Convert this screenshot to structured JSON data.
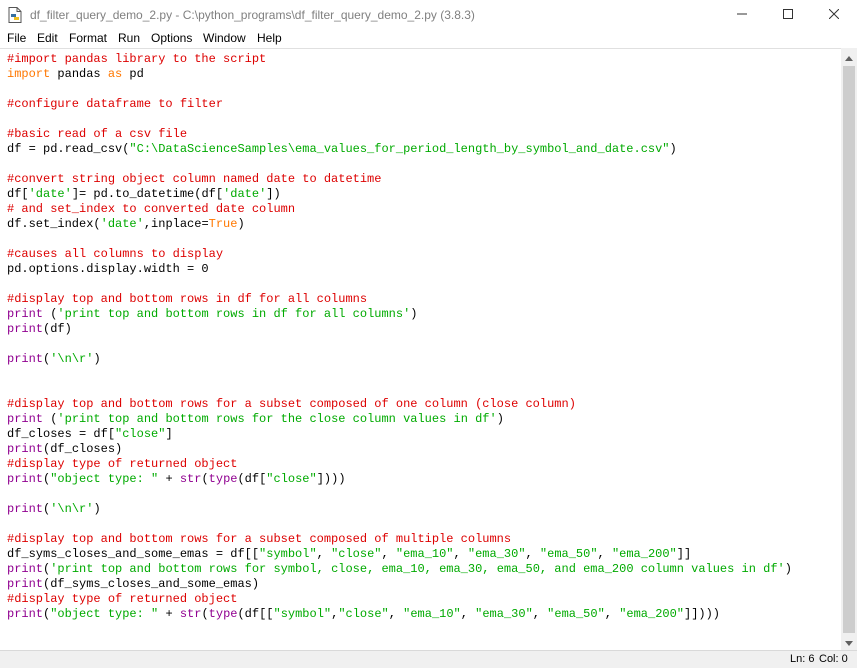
{
  "window": {
    "title": "df_filter_query_demo_2.py - C:\\python_programs\\df_filter_query_demo_2.py (3.8.3)",
    "controls": {
      "minimize": "minimize",
      "maximize": "maximize",
      "close": "close"
    }
  },
  "menu": {
    "items": [
      "File",
      "Edit",
      "Format",
      "Run",
      "Options",
      "Window",
      "Help"
    ]
  },
  "editor": {
    "colors": {
      "comment": "#dd0000",
      "keyword": "#ff7700",
      "builtin": "#900090",
      "string": "#00aa00",
      "default": "#000000"
    },
    "lines": [
      [
        [
          "comment",
          "#import pandas library to the script"
        ]
      ],
      [
        [
          "kw",
          "import"
        ],
        [
          "t",
          " pandas "
        ],
        [
          "kw",
          "as"
        ],
        [
          "t",
          " pd"
        ]
      ],
      [],
      [
        [
          "comment",
          "#configure dataframe to filter"
        ]
      ],
      [],
      [
        [
          "comment",
          "#basic read of a csv file"
        ]
      ],
      [
        [
          "t",
          "df = pd.read_csv("
        ],
        [
          "str",
          "\"C:\\DataScienceSamples\\ema_values_for_period_length_by_symbol_and_date.csv\""
        ],
        [
          "t",
          ")"
        ]
      ],
      [],
      [
        [
          "comment",
          "#convert string object column named date to datetime"
        ]
      ],
      [
        [
          "t",
          "df["
        ],
        [
          "str",
          "'date'"
        ],
        [
          "t",
          "]= pd.to_datetime(df["
        ],
        [
          "str",
          "'date'"
        ],
        [
          "t",
          "])"
        ]
      ],
      [
        [
          "comment",
          "# and set_index to converted date column"
        ]
      ],
      [
        [
          "t",
          "df.set_index("
        ],
        [
          "str",
          "'date'"
        ],
        [
          "t",
          ",inplace="
        ],
        [
          "kw",
          "True"
        ],
        [
          "t",
          ")"
        ]
      ],
      [],
      [
        [
          "comment",
          "#causes all columns to display"
        ]
      ],
      [
        [
          "t",
          "pd.options.display.width = 0"
        ]
      ],
      [],
      [
        [
          "comment",
          "#display top and bottom rows in df for all columns"
        ]
      ],
      [
        [
          "bi",
          "print"
        ],
        [
          "t",
          " ("
        ],
        [
          "str",
          "'print top and bottom rows in df for all columns'"
        ],
        [
          "t",
          ")"
        ]
      ],
      [
        [
          "bi",
          "print"
        ],
        [
          "t",
          "(df)"
        ]
      ],
      [],
      [
        [
          "bi",
          "print"
        ],
        [
          "t",
          "("
        ],
        [
          "str",
          "'\\n\\r'"
        ],
        [
          "t",
          ")"
        ]
      ],
      [],
      [],
      [
        [
          "comment",
          "#display top and bottom rows for a subset composed of one column (close column)"
        ]
      ],
      [
        [
          "bi",
          "print"
        ],
        [
          "t",
          " ("
        ],
        [
          "str",
          "'print top and bottom rows for the close column values in df'"
        ],
        [
          "t",
          ")"
        ]
      ],
      [
        [
          "t",
          "df_closes = df["
        ],
        [
          "str",
          "\"close\""
        ],
        [
          "t",
          "]"
        ]
      ],
      [
        [
          "bi",
          "print"
        ],
        [
          "t",
          "(df_closes)"
        ]
      ],
      [
        [
          "comment",
          "#display type of returned object"
        ]
      ],
      [
        [
          "bi",
          "print"
        ],
        [
          "t",
          "("
        ],
        [
          "str",
          "\"object type: \""
        ],
        [
          "t",
          " + "
        ],
        [
          "bi",
          "str"
        ],
        [
          "t",
          "("
        ],
        [
          "bi",
          "type"
        ],
        [
          "t",
          "(df["
        ],
        [
          "str",
          "\"close\""
        ],
        [
          "t",
          "])))"
        ]
      ],
      [],
      [
        [
          "bi",
          "print"
        ],
        [
          "t",
          "("
        ],
        [
          "str",
          "'\\n\\r'"
        ],
        [
          "t",
          ")"
        ]
      ],
      [],
      [
        [
          "comment",
          "#display top and bottom rows for a subset composed of multiple columns"
        ]
      ],
      [
        [
          "t",
          "df_syms_closes_and_some_emas = df[["
        ],
        [
          "str",
          "\"symbol\""
        ],
        [
          "t",
          ", "
        ],
        [
          "str",
          "\"close\""
        ],
        [
          "t",
          ", "
        ],
        [
          "str",
          "\"ema_10\""
        ],
        [
          "t",
          ", "
        ],
        [
          "str",
          "\"ema_30\""
        ],
        [
          "t",
          ", "
        ],
        [
          "str",
          "\"ema_50\""
        ],
        [
          "t",
          ", "
        ],
        [
          "str",
          "\"ema_200\""
        ],
        [
          "t",
          "]]"
        ]
      ],
      [
        [
          "bi",
          "print"
        ],
        [
          "t",
          "("
        ],
        [
          "str",
          "'print top and bottom rows for symbol, close, ema_10, ema_30, ema_50, and ema_200 column values in df'"
        ],
        [
          "t",
          ")"
        ]
      ],
      [
        [
          "bi",
          "print"
        ],
        [
          "t",
          "(df_syms_closes_and_some_emas)"
        ]
      ],
      [
        [
          "comment",
          "#display type of returned object"
        ]
      ],
      [
        [
          "bi",
          "print"
        ],
        [
          "t",
          "("
        ],
        [
          "str",
          "\"object type: \""
        ],
        [
          "t",
          " + "
        ],
        [
          "bi",
          "str"
        ],
        [
          "t",
          "("
        ],
        [
          "bi",
          "type"
        ],
        [
          "t",
          "(df[["
        ],
        [
          "str",
          "\"symbol\""
        ],
        [
          "t",
          ","
        ],
        [
          "str",
          "\"close\""
        ],
        [
          "t",
          ", "
        ],
        [
          "str",
          "\"ema_10\""
        ],
        [
          "t",
          ", "
        ],
        [
          "str",
          "\"ema_30\""
        ],
        [
          "t",
          ", "
        ],
        [
          "str",
          "\"ema_50\""
        ],
        [
          "t",
          ", "
        ],
        [
          "str",
          "\"ema_200\""
        ],
        [
          "t",
          "]])))"
        ]
      ]
    ]
  },
  "status": {
    "line": "Ln: 6",
    "col": "Col: 0"
  }
}
